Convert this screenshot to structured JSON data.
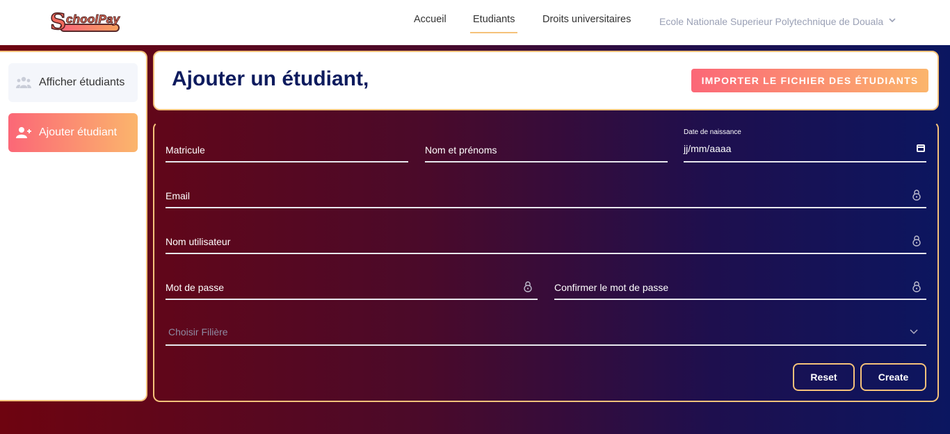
{
  "app": {
    "logo_text": "SchoolPay"
  },
  "nav": {
    "items": [
      {
        "label": "Accueil"
      },
      {
        "label": "Etudiants"
      },
      {
        "label": "Droits universitaires"
      }
    ],
    "school_select": "Ecole Nationale Superieur Polytechnique de Douala"
  },
  "sidebar": {
    "items": [
      {
        "label": "Afficher étudiants",
        "icon": "users-icon"
      },
      {
        "label": "Ajouter étudiant",
        "icon": "user-plus-icon"
      }
    ]
  },
  "header": {
    "title": "Ajouter un étudiant,",
    "import_label": "IMPORTER LE FICHIER DES ÉTUDIANTS"
  },
  "form": {
    "matricule_label": "Matricule",
    "name_label": "Nom et prénoms",
    "birthdate_label": "Date de naissance",
    "birthdate_value": "jj/mm/aaaa",
    "email_label": "Email",
    "username_label": "Nom utilisateur",
    "password_label": "Mot de passe",
    "confirm_label": "Confirmer le mot de passe",
    "filiere_placeholder": "Choisir Filière",
    "reset_label": "Reset",
    "create_label": "Create"
  },
  "colors": {
    "accent_border": "#f5c27a",
    "gradient_start": "#fb6777",
    "gradient_end": "#fbb56c",
    "title": "#0d1b5e"
  }
}
